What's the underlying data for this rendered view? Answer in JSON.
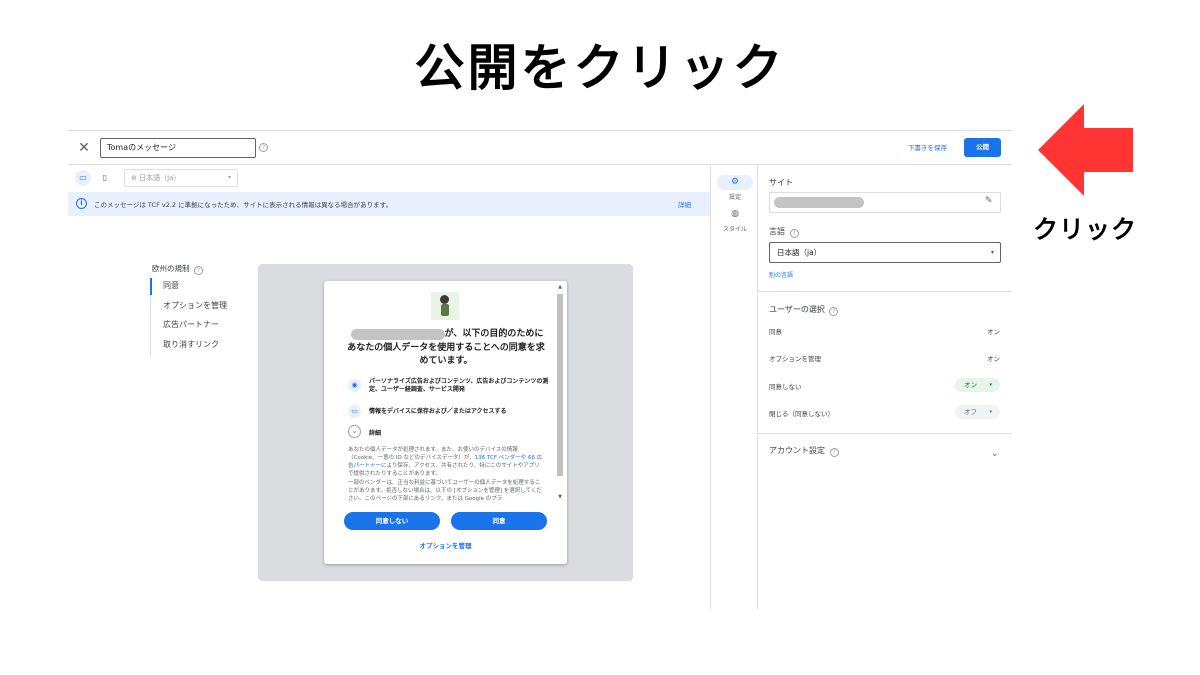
{
  "annotation": {
    "headline": "公開をクリック",
    "click_label": "クリック",
    "arrow_color": "#fe3533"
  },
  "topbar": {
    "message_name": "Tomaのメッセージ",
    "save_draft": "下書きを保存",
    "publish": "公開"
  },
  "toolbar": {
    "language": "日本語（ja）"
  },
  "infobar": {
    "text": "このメッセージは TCF v2.2 に準拠になったため、サイトに表示される情報は異なる場合があります。",
    "link": "詳細"
  },
  "nav": {
    "title": "欧州の規制",
    "items": [
      "同意",
      "オプションを管理",
      "広告パートナー",
      "取り消すリンク"
    ]
  },
  "dialog": {
    "heading_line1": "が、以下の目的のために",
    "heading_line2": "あなたの個人データを使用することへの同意を求",
    "heading_line3": "めています。",
    "purpose1": "パーソナライズ広告およびコンテンツ、広告およびコンテンツの測定、ユーザー経調査、サービス開発",
    "purpose2": "情報をデバイスに保存および／またはアクセスする",
    "details": "詳細",
    "body1_a": "あなたの個人データが処理されます。また、お使いのデバイスの情報（Cookie、一意の ID などのデバイスデータ）が、",
    "body1_link": "136 TCF ベンダーや 66 広告パートナー",
    "body1_b": "により保存、アクセス、共有されたり、特にこのサイトやアプリで提供されたりすることがあります。",
    "body2": "一部のベンダーは、正当な利益に基づいてユーザーの個人データを処理することがあります。拒否しない場合は、以下の [オプションを管理] を選択してください。このページの下部にあるリンク、または Google のプラ",
    "decline": "同意しない",
    "accept": "同意",
    "manage": "オプションを管理"
  },
  "rail": {
    "settings": "設定",
    "style": "スタイル"
  },
  "panel": {
    "site_label": "サイト",
    "language_label": "言語",
    "language_value": "日本語（ja）",
    "other_language": "別の言語",
    "user_choice_label": "ユーザーの選択",
    "choices": [
      {
        "label": "同意",
        "value": "オン"
      },
      {
        "label": "オプションを管理",
        "value": "オン"
      },
      {
        "label": "同意しない",
        "value": "オン"
      },
      {
        "label": "閉じる（同意しない）",
        "value": "オフ"
      }
    ],
    "account_label": "アカウント設定"
  }
}
